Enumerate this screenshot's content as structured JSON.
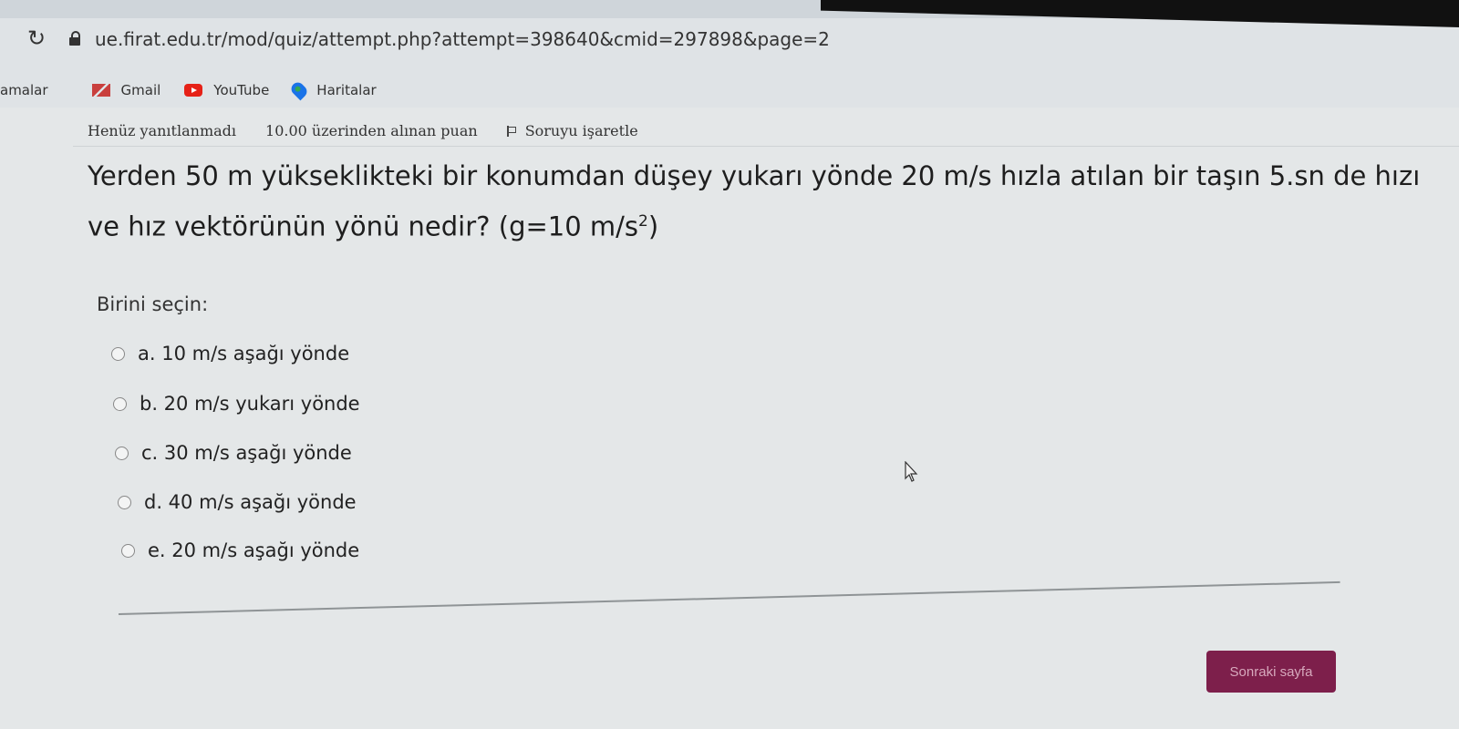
{
  "browser": {
    "url": "ue.firat.edu.tr/mod/quiz/attempt.php?attempt=398640&cmid=297898&page=2",
    "bookmarks": [
      {
        "label": "amalar",
        "icon": "apps-icon"
      },
      {
        "label": "Gmail",
        "icon": "gmail-icon"
      },
      {
        "label": "YouTube",
        "icon": "youtube-icon"
      },
      {
        "label": "Haritalar",
        "icon": "maps-icon"
      }
    ]
  },
  "question_info": {
    "status": "Henüz yanıtlanmadı",
    "grade": "10.00 üzerinden alınan puan",
    "flag_label": "Soruyu işaretle"
  },
  "question": {
    "text_main": "Yerden 50 m yükseklikteki bir konumdan düşey yukarı yönde 20 m/s hızla atılan bir taşın 5.sn de hızı ve hız vektörünün yönü nedir? (g=10 m/s",
    "sup": "2",
    "text_end": ")",
    "prompt": "Birini seçin:",
    "options": [
      {
        "label": "a. 10 m/s aşağı yönde"
      },
      {
        "label": "b. 20 m/s yukarı yönde"
      },
      {
        "label": "c. 30 m/s aşağı yönde"
      },
      {
        "label": "d. 40 m/s aşağı yönde"
      },
      {
        "label": "e. 20 m/s aşağı yönde"
      }
    ]
  },
  "nav": {
    "next_label": "Sonraki sayfa"
  },
  "colors": {
    "next_button": "#7d1f4b",
    "background": "#e4e7e8"
  }
}
